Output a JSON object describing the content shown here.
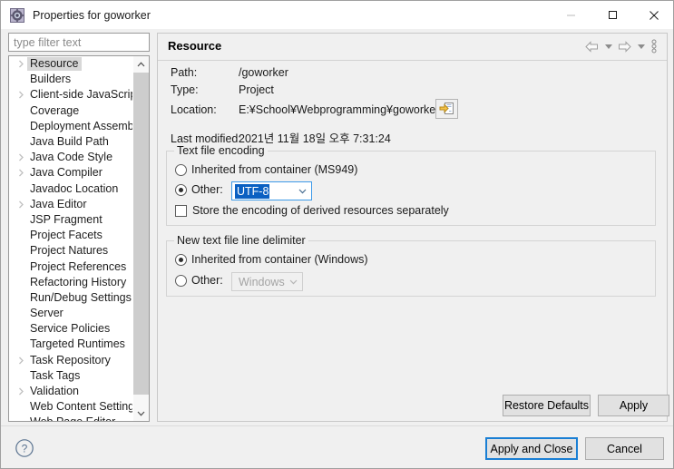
{
  "window": {
    "title": "Properties for goworker",
    "icon": "properties-gear-icon",
    "controls": {
      "minimize": "minimize-icon",
      "maximize": "maximize-icon",
      "close": "close-icon"
    }
  },
  "sidebar": {
    "filter": {
      "placeholder": "type filter text",
      "value": ""
    },
    "items": [
      {
        "label": "Resource",
        "expandable": true,
        "selected": true
      },
      {
        "label": "Builders",
        "expandable": false,
        "selected": false
      },
      {
        "label": "Client-side JavaScript",
        "expandable": true,
        "selected": false
      },
      {
        "label": "Coverage",
        "expandable": false,
        "selected": false
      },
      {
        "label": "Deployment Assembly",
        "expandable": false,
        "selected": false
      },
      {
        "label": "Java Build Path",
        "expandable": false,
        "selected": false
      },
      {
        "label": "Java Code Style",
        "expandable": true,
        "selected": false
      },
      {
        "label": "Java Compiler",
        "expandable": true,
        "selected": false
      },
      {
        "label": "Javadoc Location",
        "expandable": false,
        "selected": false
      },
      {
        "label": "Java Editor",
        "expandable": true,
        "selected": false
      },
      {
        "label": "JSP Fragment",
        "expandable": false,
        "selected": false
      },
      {
        "label": "Project Facets",
        "expandable": false,
        "selected": false
      },
      {
        "label": "Project Natures",
        "expandable": false,
        "selected": false
      },
      {
        "label": "Project References",
        "expandable": false,
        "selected": false
      },
      {
        "label": "Refactoring History",
        "expandable": false,
        "selected": false
      },
      {
        "label": "Run/Debug Settings",
        "expandable": false,
        "selected": false
      },
      {
        "label": "Server",
        "expandable": false,
        "selected": false
      },
      {
        "label": "Service Policies",
        "expandable": false,
        "selected": false
      },
      {
        "label": "Targeted Runtimes",
        "expandable": false,
        "selected": false
      },
      {
        "label": "Task Repository",
        "expandable": true,
        "selected": false
      },
      {
        "label": "Task Tags",
        "expandable": false,
        "selected": false
      },
      {
        "label": "Validation",
        "expandable": true,
        "selected": false
      },
      {
        "label": "Web Content Settings",
        "expandable": false,
        "selected": false
      },
      {
        "label": "Web Page Editor",
        "expandable": false,
        "selected": false
      }
    ],
    "scrollbar": {
      "up_icon": "scroll-up-icon",
      "down_icon": "scroll-down-icon"
    }
  },
  "page": {
    "title": "Resource",
    "toolbar": {
      "back_icon": "back-arrow-icon",
      "back_menu_icon": "chevron-down-icon",
      "forward_icon": "forward-arrow-icon",
      "forward_menu_icon": "chevron-down-icon",
      "view_menu_icon": "view-menu-icon"
    },
    "info": {
      "path_label": "Path:",
      "path_value": "/goworker",
      "type_label": "Type:",
      "type_value": "Project",
      "location_label": "Location:",
      "location_value": "E:¥School¥Webprogramming¥goworker",
      "browse_icon": "show-in-explorer-icon",
      "last_modified_label": "Last modified:",
      "last_modified_value": "2021년 11월 18일 오후 7:31:24"
    },
    "encoding_group": {
      "title": "Text file encoding",
      "inherited_label": "Inherited from container (MS949)",
      "inherited_checked": false,
      "other_label": "Other:",
      "other_checked": true,
      "other_value": "UTF-8",
      "store_derived_label": "Store the encoding of derived resources separately",
      "store_derived_checked": false,
      "dropdown_icon": "chevron-down-icon"
    },
    "delimiter_group": {
      "title": "New text file line delimiter",
      "inherited_label": "Inherited from container (Windows)",
      "inherited_checked": true,
      "other_label": "Other:",
      "other_checked": false,
      "other_value": "Windows",
      "other_disabled": true,
      "dropdown_icon": "chevron-down-icon"
    },
    "restore_defaults_label": "Restore Defaults",
    "apply_label": "Apply"
  },
  "footer": {
    "help_icon": "help-icon",
    "apply_and_close_label": "Apply and Close",
    "cancel_label": "Cancel"
  },
  "colors": {
    "window_bg": "#f0f0f0",
    "panel_white": "#ffffff",
    "selection_blue": "#0a60c2",
    "focus_blue": "#1a7fd4",
    "tree_selected_gray": "#d8d8d8"
  }
}
